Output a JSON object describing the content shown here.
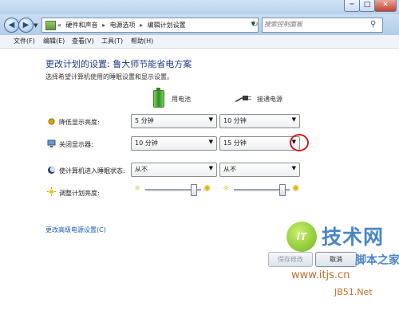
{
  "window": {
    "controls": {
      "minimize": "─",
      "maximize": "□",
      "close": "✕"
    }
  },
  "nav": {
    "back_icon": "◀",
    "forward_icon": "▶",
    "breadcrumb": [
      "«",
      "硬件和声音",
      "电源选项",
      "编辑计划设置"
    ],
    "separator": "▸",
    "refresh_icon": "refresh-icon",
    "search_placeholder": "搜索控制面板"
  },
  "menu": [
    "文件(F)",
    "编辑(E)",
    "查看(V)",
    "工具(T)",
    "帮助(H)"
  ],
  "page": {
    "title": "更改计划的设置: 鲁大师节能省电方案",
    "subtitle": "选择希望计算机使用的睡眠设置和显示设置。",
    "col_battery": "用电池",
    "col_plugged": "接通电源"
  },
  "settings": [
    {
      "label": "降低显示亮度:",
      "battery": "5 分钟",
      "plugged": "10 分钟",
      "icon": "dim-brightness-icon"
    },
    {
      "label": "关闭显示器:",
      "battery": "10 分钟",
      "plugged": "15 分钟",
      "icon": "monitor-icon"
    },
    {
      "label": "使计算机进入睡眠状态:",
      "battery": "从不",
      "plugged": "从不",
      "icon": "sleep-moon-icon"
    }
  ],
  "brightness": {
    "label": "调整计划亮度:",
    "battery_level": 0.85,
    "plugged_level": 0.85
  },
  "advanced_link": "更改高级电源设置(C)",
  "buttons": {
    "save": "保存修改",
    "cancel": "取消"
  },
  "watermark": {
    "logo": "IT",
    "big": "技术网",
    "small": "脚本之家",
    "url1": "www.itjs.cn",
    "url2": "JB51.Net"
  },
  "colors": {
    "title_blue": "#1e3a8a",
    "link_blue": "#1a5fb4",
    "highlight_red": "#d01818"
  }
}
